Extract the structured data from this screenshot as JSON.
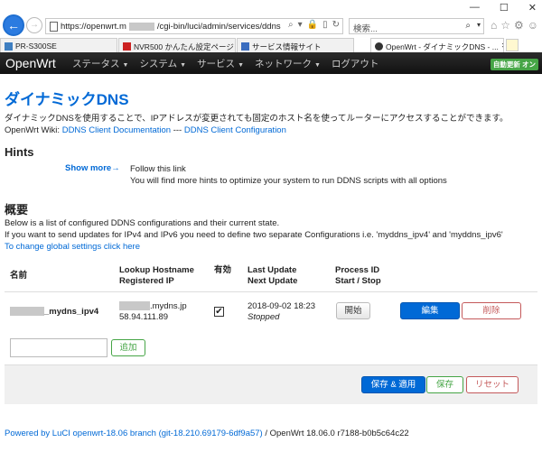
{
  "browser": {
    "url_prefix": "https://openwrt.m",
    "url_suffix": "/cgi-bin/luci/admin/services/ddns",
    "search_placeholder": "検索...",
    "tabs": [
      {
        "label": "PR-S300SE"
      },
      {
        "label": "NVR500 かんたん設定ページ [ Rev..."
      },
      {
        "label": "サービス情報サイト"
      },
      {
        "label": "OpenWrt - ダイナミックDNS - ..."
      }
    ]
  },
  "header": {
    "brand": "OpenWrt",
    "menu": [
      "ステータス",
      "システム",
      "サービス",
      "ネットワーク",
      "ログアウト"
    ],
    "autorefresh": "自動更新 オン"
  },
  "page": {
    "title": "ダイナミックDNS",
    "description": "ダイナミックDNSを使用することで、IPアドレスが変更されても固定のホスト名を使ってルーターにアクセスすることができます。",
    "wiki_prefix": "OpenWrt Wiki: ",
    "wiki_link1": "DDNS Client Documentation",
    "wiki_sep": " --- ",
    "wiki_link2": "DDNS Client Configuration"
  },
  "hints": {
    "title": "Hints",
    "show_more": "Show more→",
    "line1": "Follow this link",
    "line2": "You will find more hints to optimize your system to run DDNS scripts with all options"
  },
  "overview": {
    "title": "概要",
    "line1": "Below is a list of configured DDNS configurations and their current state.",
    "line2": "If you want to send updates for IPv4 and IPv6 you need to define two separate Configurations i.e. 'myddns_ipv4' and 'myddns_ipv6'",
    "link": "To change global settings click here"
  },
  "table": {
    "headers": {
      "name": "名前",
      "lookup1": "Lookup Hostname",
      "lookup2": "Registered IP",
      "enabled": "有効",
      "update1": "Last Update",
      "update2": "Next Update",
      "process1": "Process ID",
      "process2": "Start / Stop"
    },
    "row": {
      "name_suffix": "_mydns_ipv4",
      "hostname_suffix": ".mydns.jp",
      "ip": "58.94.111.89",
      "checkmark": "✔",
      "last_update": "2018-09-02 18:23",
      "next_update": "Stopped",
      "start_label": "開始",
      "edit_label": "編集",
      "delete_label": "削除"
    },
    "add_label": "追加"
  },
  "actions": {
    "save_apply": "保存 & 適用",
    "save": "保存",
    "reset": "リセット"
  },
  "footer": {
    "link": "Powered by LuCI openwrt-18.06 branch (git-18.210.69179-6df9a57)",
    "text": " / OpenWrt 18.06.0 r7188-b0b5c64c22"
  }
}
